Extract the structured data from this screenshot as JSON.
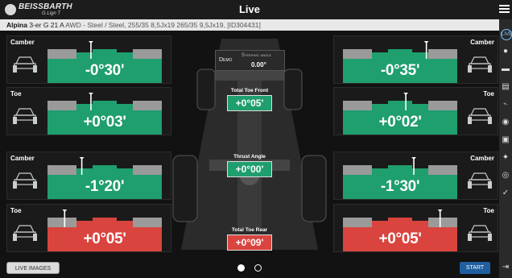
{
  "app": {
    "logo_brand": "BEISSBARTH",
    "logo_sub": "G.Lign T",
    "title": "Live"
  },
  "vehicle": {
    "make": "Alpina",
    "model": "3-er G 21 A",
    "spec": "AWD - Steel / Steel, 255/35 8,5Jx19 265/35 9,5Jx19, [ID304431]"
  },
  "panels": {
    "fl_camber": {
      "label": "Camber",
      "value": "-0°30'",
      "status": "green",
      "needle": 0.38
    },
    "fr_camber": {
      "label": "Camber",
      "value": "-0°35'",
      "status": "green",
      "needle": 0.73
    },
    "fl_toe": {
      "label": "Toe",
      "value": "+0°03'",
      "status": "green",
      "needle": 0.38
    },
    "fr_toe": {
      "label": "Toe",
      "value": "+0°02'",
      "status": "green",
      "needle": 0.55
    },
    "rl_camber": {
      "label": "Camber",
      "value": "-1°20'",
      "status": "green",
      "needle": 0.3
    },
    "rr_camber": {
      "label": "Camber",
      "value": "-1°30'",
      "status": "green",
      "needle": 0.62
    },
    "rl_toe": {
      "label": "Toe",
      "value": "+0°05'",
      "status": "red",
      "needle": 0.15
    },
    "rr_toe": {
      "label": "Toe",
      "value": "+0°05'",
      "status": "red",
      "needle": 0.85
    }
  },
  "center": {
    "demo_label": "Demo",
    "steering_label": "Steering angle",
    "steering_value": "0.00°",
    "total_toe_front_label": "Total Toe Front",
    "total_toe_front_value": "+0°05'",
    "total_toe_front_status": "green",
    "thrust_angle_label": "Thrust Angle",
    "thrust_angle_value": "+0°00'",
    "thrust_angle_status": "green",
    "total_toe_rear_label": "Total Toe Rear",
    "total_toe_rear_value": "+0°09'",
    "total_toe_rear_status": "red"
  },
  "footer": {
    "live_images_label": "LIVE IMAGES",
    "start_label": "START",
    "pages": [
      true,
      false
    ]
  },
  "colors": {
    "green": "#1f9e6e",
    "red": "#d9443e",
    "accent": "#1f5f9f"
  },
  "rail_icons": [
    "live-icon",
    "person-icon",
    "car-side-icon",
    "report-icon",
    "adjust-icon",
    "wheel-icon",
    "clipboard-icon",
    "wrench-icon",
    "tire-icon",
    "check-circle-icon",
    "exit-icon"
  ]
}
